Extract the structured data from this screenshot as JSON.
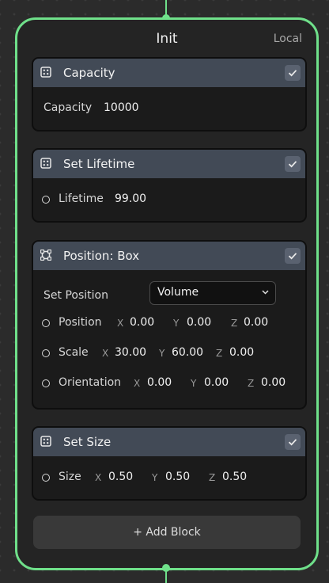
{
  "node": {
    "title": "Init",
    "space": "Local"
  },
  "blocks": {
    "capacity": {
      "title": "Capacity",
      "icon": "dice-icon",
      "enabled": true,
      "label": "Capacity",
      "value": "10000"
    },
    "lifetime": {
      "title": "Set Lifetime",
      "icon": "dice-icon",
      "enabled": true,
      "label": "Lifetime",
      "value": "99.00"
    },
    "position": {
      "title": "Position: Box",
      "icon": "bounding-box-icon",
      "enabled": true,
      "set_label": "Set Position",
      "mode": "Volume",
      "position": {
        "label": "Position",
        "x": "0.00",
        "y": "0.00",
        "z": "0.00"
      },
      "scale": {
        "label": "Scale",
        "x": "30.00",
        "y": "60.00",
        "z": "0.00"
      },
      "orientation": {
        "label": "Orientation",
        "x": "0.00",
        "y": "0.00",
        "z": "0.00"
      }
    },
    "size": {
      "title": "Set Size",
      "icon": "dice-icon",
      "enabled": true,
      "label": "Size",
      "x": "0.50",
      "y": "0.50",
      "z": "0.50"
    }
  },
  "axes": {
    "x": "X",
    "y": "Y",
    "z": "Z"
  },
  "add_block_label": "+ Add Block",
  "colors": {
    "accent": "#6fe08a",
    "header": "#424a56",
    "node_bg": "#242424",
    "block_bg": "#1b1b1b"
  }
}
